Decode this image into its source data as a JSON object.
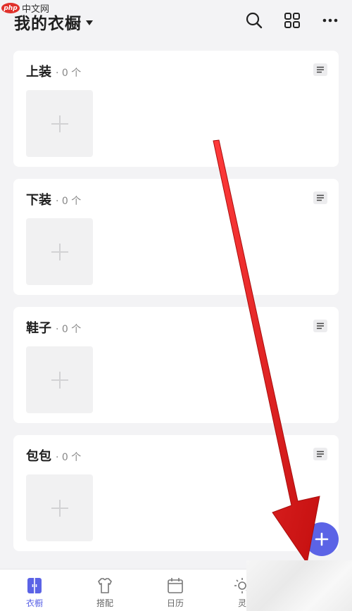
{
  "watermark": {
    "logo": "php",
    "text": "中文网"
  },
  "header": {
    "title": "我的衣橱"
  },
  "categories": [
    {
      "name": "上装",
      "count": "· 0 个"
    },
    {
      "name": "下装",
      "count": "· 0 个"
    },
    {
      "name": "鞋子",
      "count": "· 0 个"
    },
    {
      "name": "包包",
      "count": "· 0 个"
    }
  ],
  "bottom_nav": {
    "items": [
      {
        "label": "衣橱",
        "icon": "wardrobe-icon",
        "active": true
      },
      {
        "label": "搭配",
        "icon": "outfit-icon",
        "active": false
      },
      {
        "label": "日历",
        "icon": "calendar-icon",
        "active": false
      },
      {
        "label": "灵",
        "icon": "inspiration-icon",
        "active": false
      }
    ]
  },
  "colors": {
    "accent": "#5b63e6",
    "background": "#f3f3f5",
    "card": "#ffffff",
    "annotation": "#e31b1b"
  }
}
